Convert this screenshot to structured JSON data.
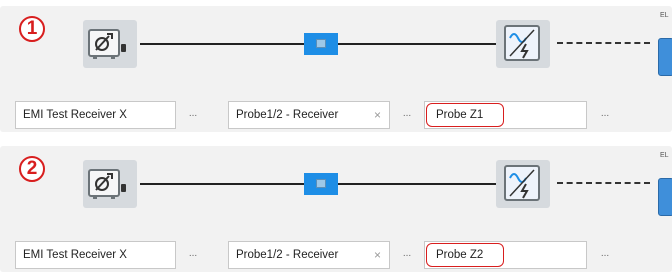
{
  "panels": [
    {
      "step": "1",
      "edge_label": "EL",
      "receiver_field": "EMI Test Receiver X",
      "probe12_field": "Probe1/2 - Receiver",
      "probez_field": "Probe Z1",
      "browse_label": "...",
      "clear_symbol": "×"
    },
    {
      "step": "2",
      "edge_label": "EL",
      "receiver_field": "EMI Test Receiver X",
      "probe12_field": "Probe1/2 - Receiver",
      "probez_field": "Probe Z2",
      "browse_label": "...",
      "clear_symbol": "×"
    }
  ],
  "colors": {
    "highlight_red": "#d81e1e",
    "connector_blue": "#1e8ee6",
    "device_gray": "#d6dade"
  },
  "icons": [
    "receiver-device-icon",
    "coupler-icon",
    "probe-device-icon",
    "device-icon"
  ]
}
